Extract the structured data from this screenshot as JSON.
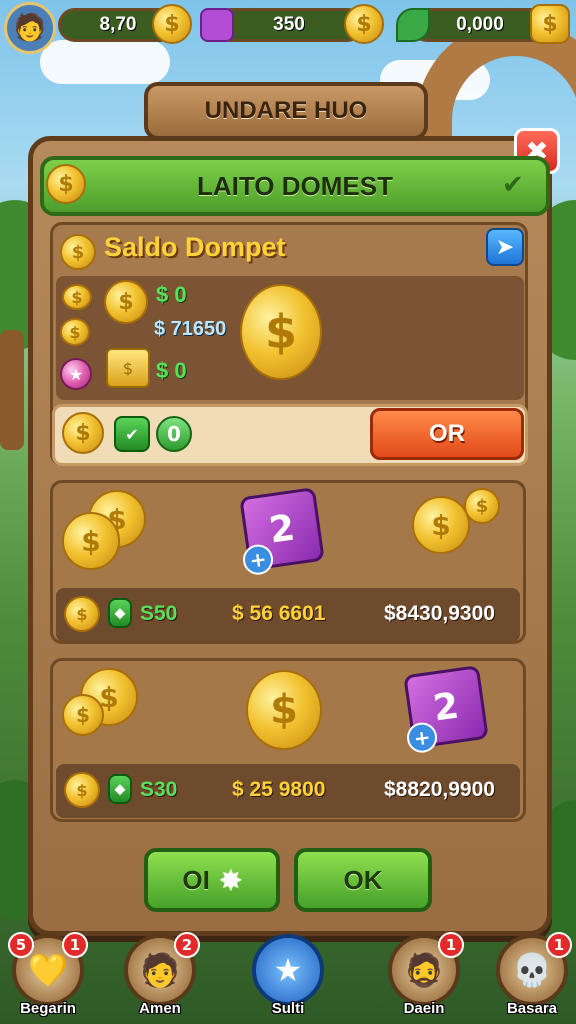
{
  "topbar": {
    "coins": "8,70",
    "gems": "350",
    "leaves": "0,000",
    "coin_glyph": "$"
  },
  "header": {
    "plate_title": "UNDARE HUO",
    "banner_title": "LAITO DOMEST"
  },
  "wallet": {
    "title": "Saldo Dompet",
    "value_top": "$ 0",
    "value_main": "$ 71650",
    "value_bottom": "$ 0",
    "action_value": "0",
    "action_button": "OR"
  },
  "offers": [
    {
      "strip_value": "S50",
      "price_mid": "$ 56 6601",
      "price_right": "$8430,9300",
      "badge": "2"
    },
    {
      "strip_value": "S30",
      "price_mid": "$ 25 9800",
      "price_right": "$8820,9900",
      "badge": "2"
    }
  ],
  "footer": {
    "btn_left": "OI",
    "btn_right": "OK"
  },
  "nav": [
    {
      "label": "Begarin",
      "badge": "1",
      "badge_left": "5",
      "icon": "gold-gem-icon"
    },
    {
      "label": "Amen",
      "badge": "2",
      "icon": "character-icon"
    },
    {
      "label": "Sulti",
      "icon": "star-icon"
    },
    {
      "label": "Daein",
      "badge": "1",
      "icon": "character-icon"
    },
    {
      "label": "Basara",
      "badge": "1",
      "icon": "skull-icon"
    }
  ],
  "colors": {
    "panel": "#b78a5c",
    "banner_green": "#7ed04a",
    "gold": "#ffd23a",
    "action_red": "#e24a1a",
    "close_red": "#d62b1f"
  }
}
